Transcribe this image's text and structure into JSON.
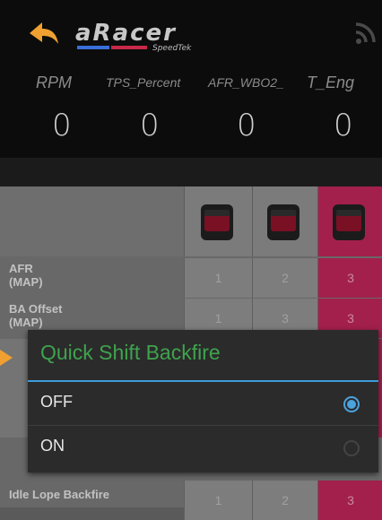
{
  "header": {
    "logo_text": "aRacer",
    "logo_subtext": "SpeedTek",
    "accent_orange": "#f0a030",
    "icons": [
      "back-arrow-icon",
      "wifi-icon"
    ]
  },
  "gauges": [
    {
      "label": "RPM",
      "value": "0"
    },
    {
      "label": "TPS_Percent",
      "value": "0"
    },
    {
      "label": "AFR_WBO2_",
      "value": "0"
    },
    {
      "label": "T_Eng",
      "value": "0"
    }
  ],
  "table": {
    "rows": [
      {
        "label_line1": "AFR",
        "label_line2": "(MAP)",
        "values": [
          "1",
          "2",
          "3"
        ]
      },
      {
        "label_line1": "BA Offset",
        "label_line2": "(MAP)",
        "values": [
          "1",
          "3",
          "3"
        ]
      },
      {
        "label_line1": "Idle Lope Backfire",
        "label_line2": "",
        "values": [
          "1",
          "2",
          "3"
        ]
      }
    ],
    "accent_color": "#a3204c"
  },
  "dialog": {
    "title": "Quick Shift Backfire",
    "options": [
      {
        "label": "OFF",
        "selected": true
      },
      {
        "label": "ON",
        "selected": false
      }
    ],
    "title_color": "#3fa34d",
    "divider_color": "#3d9bd9"
  }
}
